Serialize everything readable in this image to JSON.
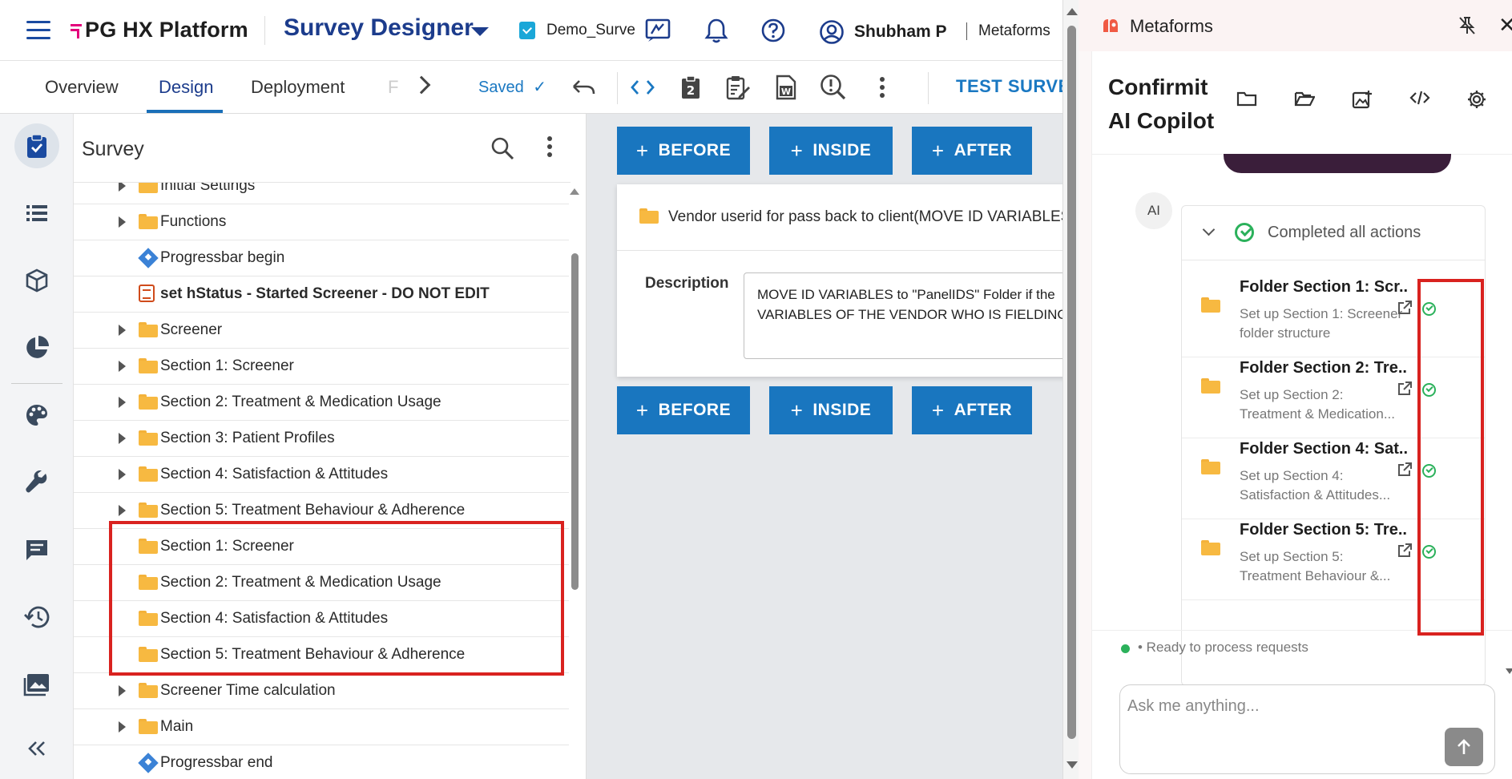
{
  "header": {
    "brand": "PG HX Platform",
    "app_title": "Survey Designer",
    "survey_name": "Demo_Survey",
    "user_name": "Shubham P",
    "tenant": "Metaforms"
  },
  "tabs": {
    "items": [
      "Overview",
      "Design",
      "Deployment",
      "F"
    ],
    "active": "Design",
    "saved_label": "Saved",
    "test_survey_label": "TEST SURVEY"
  },
  "sidebar": {
    "icons": [
      "clipboard-check-icon",
      "list-icon",
      "cube-icon",
      "pie-chart-icon",
      "palette-icon",
      "wrench-icon",
      "message-icon",
      "history-icon",
      "images-icon",
      "collapse-icon"
    ]
  },
  "tree": {
    "title": "Survey",
    "rows": [
      {
        "label": "Initial Settings",
        "type": "folder",
        "expandable": true
      },
      {
        "label": "Functions",
        "type": "folder",
        "expandable": true
      },
      {
        "label": "Progressbar begin",
        "type": "diamond",
        "expandable": false
      },
      {
        "label": "set hStatus - Started Screener - DO NOT EDIT",
        "type": "script",
        "expandable": false,
        "bold": true
      },
      {
        "label": "Screener",
        "type": "folder",
        "expandable": true
      },
      {
        "label": "Section 1: Screener",
        "type": "folder",
        "expandable": true
      },
      {
        "label": "Section 2: Treatment & Medication Usage",
        "type": "folder",
        "expandable": true
      },
      {
        "label": "Section 3: Patient Profiles",
        "type": "folder",
        "expandable": true
      },
      {
        "label": "Section 4: Satisfaction & Attitudes",
        "type": "folder",
        "expandable": true
      },
      {
        "label": "Section 5: Treatment Behaviour & Adherence",
        "type": "folder",
        "expandable": true
      },
      {
        "label": "Section 1: Screener",
        "type": "folder",
        "expandable": false
      },
      {
        "label": "Section 2: Treatment & Medication Usage",
        "type": "folder",
        "expandable": false
      },
      {
        "label": "Section 4: Satisfaction & Attitudes",
        "type": "folder",
        "expandable": false
      },
      {
        "label": "Section 5: Treatment Behaviour & Adherence",
        "type": "folder",
        "expandable": false
      },
      {
        "label": "Screener Time calculation",
        "type": "folder",
        "expandable": true
      },
      {
        "label": "Main",
        "type": "folder",
        "expandable": true
      },
      {
        "label": "Progressbar end",
        "type": "diamond",
        "expandable": false
      }
    ]
  },
  "canvas": {
    "before_label": "BEFORE",
    "inside_label": "INSIDE",
    "after_label": "AFTER",
    "card_title": "Vendor userid for pass back to client(MOVE ID VARIABLES",
    "description_label": "Description",
    "description_line1": "MOVE ID VARIABLES to \"PanelIDS\" Folder if the",
    "description_line2": "VARIABLES OF THE VENDOR WHO IS FIELDING I"
  },
  "copilot": {
    "window_title": "Metaforms",
    "heading_line1": "Confirmit",
    "heading_line2": "AI Copilot",
    "avatar": "AI",
    "completed_label": "Completed all actions",
    "actions": [
      {
        "title": "Folder Section 1: Scr...",
        "sub1": "Set up Section 1: Screener",
        "sub2": "folder structure"
      },
      {
        "title": "Folder Section 2: Tre...",
        "sub1": "Set up Section 2:",
        "sub2": "Treatment & Medication..."
      },
      {
        "title": "Folder Section 4: Sat...",
        "sub1": "Set up Section 4:",
        "sub2": "Satisfaction & Attitudes..."
      },
      {
        "title": "Folder Section 5: Tre...",
        "sub1": "Set up Section 5:",
        "sub2": "Treatment Behaviour &..."
      }
    ],
    "status": "• Ready to process requests",
    "input_placeholder": "Ask me anything..."
  },
  "colors": {
    "primary_blue": "#1976bf",
    "navy": "#1c3c8c",
    "folder": "#f7b941",
    "success": "#2bb15b",
    "highlight_red": "#d9221f"
  }
}
